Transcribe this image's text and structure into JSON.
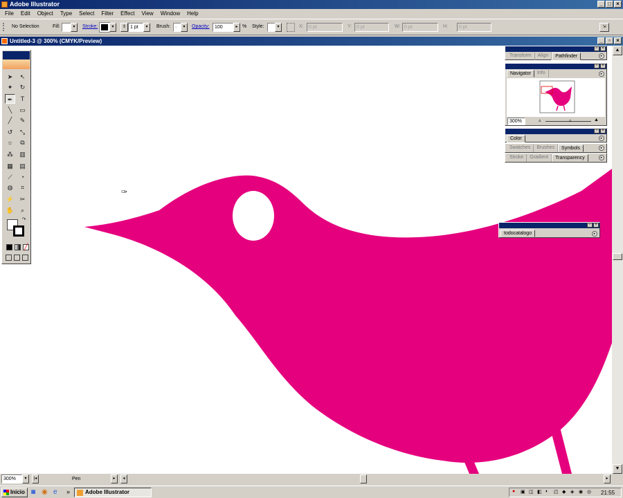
{
  "app": {
    "title": "Adobe Illustrator",
    "menus": [
      "File",
      "Edit",
      "Object",
      "Type",
      "Select",
      "Filter",
      "Effect",
      "View",
      "Window",
      "Help"
    ]
  },
  "control": {
    "selection": "No Selection",
    "fill_label": "Fill:",
    "stroke_label": "Stroke:",
    "stroke_weight": "1 pt",
    "brush_label": "Brush:",
    "opacity_label": "Opacity:",
    "opacity_value": "100",
    "opacity_unit": "%",
    "style_label": "Style:",
    "x_label": "X:",
    "x_value": "0 pt",
    "y_label": "Y:",
    "y_value": "0 pt",
    "w_label": "W:",
    "w_value": "0 pt",
    "h_label": "H:",
    "h_value": "0 pt"
  },
  "document": {
    "title": "Untitled-3 @ 300% (CMYK/Preview)",
    "zoom": "300%",
    "status_tool": "Pen",
    "artwork_color": "#e5007e"
  },
  "panels": {
    "group1_tabs": [
      "Transform",
      "Align",
      "Pathfinder"
    ],
    "group1_active": "Pathfinder",
    "navigator_tabs": [
      "Navigator",
      "Info"
    ],
    "navigator_zoom": "300%",
    "color_tab": "Color",
    "group3_tabs": [
      "Swatches",
      "Brushes",
      "Symbols"
    ],
    "group3_active": "Symbols",
    "group4_tabs": [
      "Stroke",
      "Gradient",
      "Transparency"
    ],
    "group4_active": "Transparency",
    "floating_tab": "todocatalogo"
  },
  "taskbar": {
    "start": "Inicio",
    "app_button": "Adobe Illustrator",
    "clock": "21:55"
  }
}
